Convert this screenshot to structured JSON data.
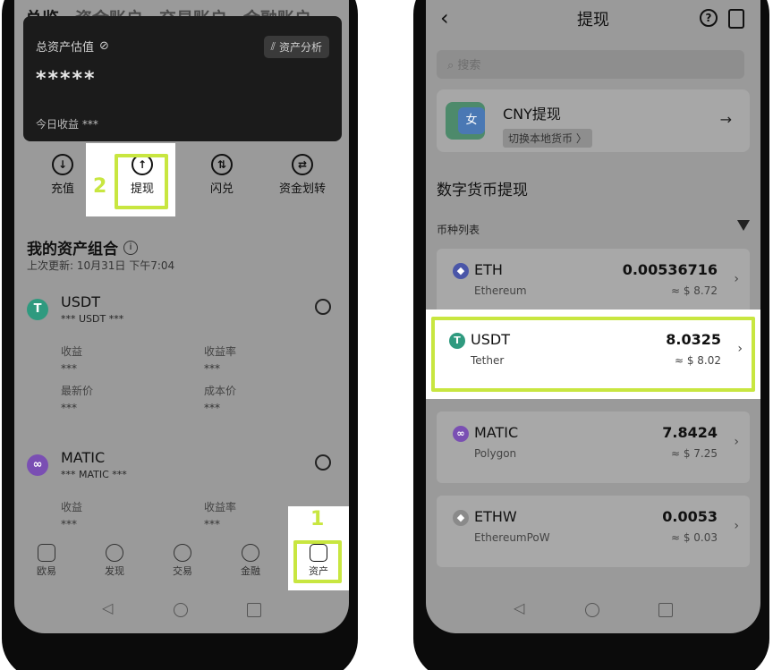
{
  "left": {
    "top_tabs": [
      "总览",
      "资金账户",
      "交易账户",
      "金融账户"
    ],
    "asset_card": {
      "label": "总资产估值",
      "analysis": "资产分析",
      "masked_value": "*****",
      "today_profit": "今日收益 ***"
    },
    "actions": [
      "充值",
      "提现",
      "闪兑",
      "资金划转"
    ],
    "step_2": "2",
    "section_title": "我的资产组合",
    "updated": "上次更新: 10月31日 下午7:04",
    "coins": [
      {
        "name": "USDT",
        "sub": "*** USDT ***",
        "icon_color": "#2f9a7f",
        "icon_letter": "T",
        "stats": [
          {
            "label": "收益",
            "value": "***"
          },
          {
            "label": "收益率",
            "value": "***"
          },
          {
            "label": "最新价",
            "value": "***"
          },
          {
            "label": "成本价",
            "value": "***"
          }
        ]
      },
      {
        "name": "MATIC",
        "sub": "*** MATIC ***",
        "icon_color": "#7a4fb3",
        "icon_letter": "∞",
        "stats": [
          {
            "label": "收益",
            "value": "***"
          },
          {
            "label": "收益率",
            "value": "***"
          }
        ]
      }
    ],
    "tabbar": [
      "欧易",
      "发现",
      "交易",
      "金融",
      "资产"
    ],
    "step_1": "1"
  },
  "right": {
    "title": "提现",
    "back": "‹",
    "help": "?",
    "search_placeholder": "搜索",
    "cny": {
      "title": "CNY提现",
      "subtitle": "切换本地货币 〉",
      "arrow": "→",
      "badge_glyph": "女"
    },
    "section": "数字货币提现",
    "list_head": "币种列表",
    "coins": [
      {
        "symbol": "ETH",
        "full": "Ethereum",
        "amount": "0.00536716",
        "fiat": "≈ $ 8.72",
        "icon_color": "#4a56a8",
        "icon_glyph": "◆"
      },
      {
        "symbol": "USDT",
        "full": "Tether",
        "amount": "8.0325",
        "fiat": "≈ $ 8.02",
        "icon_color": "#2f9a7f",
        "icon_glyph": "T"
      },
      {
        "symbol": "MATIC",
        "full": "Polygon",
        "amount": "7.8424",
        "fiat": "≈ $ 7.25",
        "icon_color": "#7a4fb3",
        "icon_glyph": "∞"
      },
      {
        "symbol": "ETHW",
        "full": "EthereumPoW",
        "amount": "0.0053",
        "fiat": "≈ $ 0.03",
        "icon_color": "#8a8a8a",
        "icon_glyph": "◆"
      }
    ]
  },
  "colors": {
    "highlight": "#c8e640",
    "dim_bg": "#9a9a9a"
  }
}
